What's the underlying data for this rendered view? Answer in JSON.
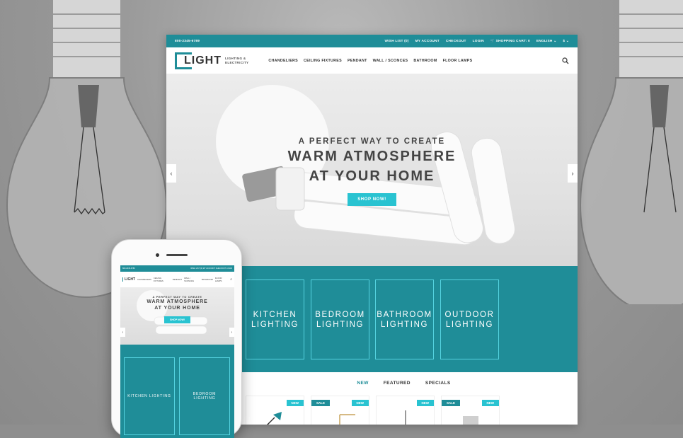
{
  "topbar": {
    "phone": "800-2345-6789",
    "links": [
      "WISH LIST (0)",
      "MY ACCOUNT",
      "CHECKOUT",
      "LOGIN"
    ],
    "cart": "SHOPPING CART: 0",
    "language": "ENGLISH",
    "currency": "$"
  },
  "logo": {
    "word": "LIGHT",
    "tagline1": "LIGHTING &",
    "tagline2": "ELECTRICITY"
  },
  "nav": [
    "CHANDELIERS",
    "CEILING FIXTURES",
    "PENDANT",
    "WALL / SCONCES",
    "BATHROOM",
    "FLOOR LAMPS"
  ],
  "hero": {
    "subtitle": "A PERFECT WAY TO CREATE",
    "title1": "WARM ATMOSPHERE",
    "title2": "AT YOUR HOME",
    "button": "SHOP NOW!",
    "prev": "‹",
    "next": "›"
  },
  "categories": [
    {
      "line1": "KITCHEN",
      "line2": "LIGHTING"
    },
    {
      "line1": "BEDROOM",
      "line2": "LIGHTING"
    },
    {
      "line1": "BATHROOM",
      "line2": "LIGHTING"
    },
    {
      "line1": "OUTDOOR",
      "line2": "LIGHTING"
    }
  ],
  "tabs": [
    "NEW",
    "FEATURED",
    "SPECIALS"
  ],
  "products": [
    {
      "new": "NEW",
      "sale": ""
    },
    {
      "new": "NEW",
      "sale": "SALE"
    },
    {
      "new": "NEW",
      "sale": ""
    },
    {
      "new": "NEW",
      "sale": "SALE"
    }
  ],
  "mobile": {
    "phone": "800-2345-6789",
    "links": "WISH LIST (0)   MY ACCOUNT   CHECKOUT   LOGIN",
    "nav": [
      "CHANDELIERS",
      "CEILING FIXTURES",
      "PENDANT",
      "WALL / SCONCES",
      "BATHROOM",
      "FLOOR LAMPS"
    ],
    "hero_sub": "A PERFECT WAY TO CREATE",
    "hero_title1": "WARM ATMOSPHERE",
    "hero_title2": "AT YOUR HOME",
    "button": "SHOP NOW!",
    "cat1": "KITCHEN LIGHTING",
    "cat2_l1": "BEDROOM",
    "cat2_l2": "LIGHTING"
  },
  "colors": {
    "teal": "#1f8d98",
    "accent": "#29c3d1"
  }
}
